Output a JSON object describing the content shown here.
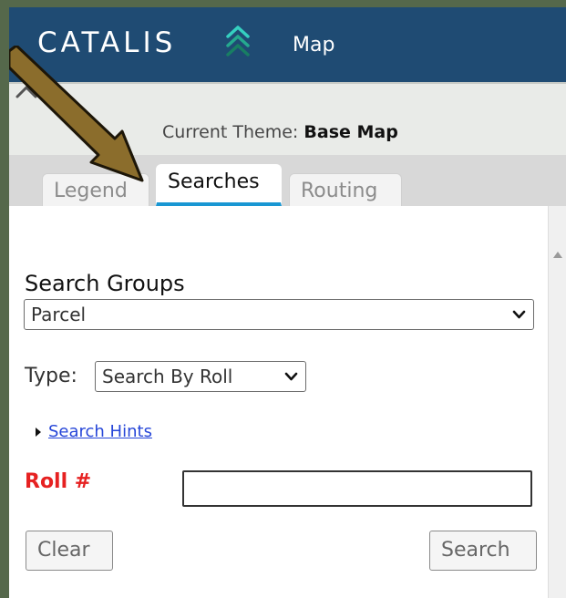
{
  "header": {
    "logo_text": "CATALIS",
    "title": "Map",
    "logo_icon": "chevron-stack-icon"
  },
  "theme": {
    "label": "Current Theme:",
    "value": "Base Map"
  },
  "tabs": [
    {
      "label": "Legend",
      "active": false
    },
    {
      "label": "Searches",
      "active": true
    },
    {
      "label": "Routing",
      "active": false
    }
  ],
  "search_groups": {
    "label": "Search Groups",
    "selected": "Parcel"
  },
  "type": {
    "label": "Type:",
    "selected": "Search By Roll"
  },
  "hints": {
    "label": "Search Hints"
  },
  "roll": {
    "label": "Roll #",
    "value": ""
  },
  "buttons": {
    "clear": "Clear",
    "search": "Search"
  },
  "colors": {
    "header_bg": "#1f4b73",
    "accent": "#1997d3",
    "required_label": "#e62121",
    "link": "#2646d8",
    "annotation_arrow": "#8b6d2c"
  },
  "icons": {
    "collapse": "chevron-collapse-icon",
    "dropdown": "chevron-down-icon",
    "scroll_up": "triangle-up-icon",
    "hint_toggle": "triangle-right-icon",
    "annotation": "pointer-arrow-icon"
  }
}
